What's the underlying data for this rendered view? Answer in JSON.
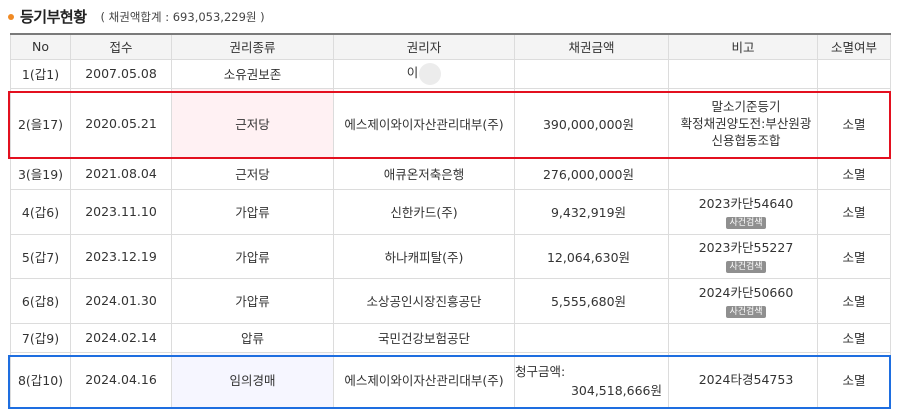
{
  "header": {
    "title": "등기부현황",
    "total_text": "( 채권액합계 : 693,053,229원 )"
  },
  "columns": [
    "No",
    "접수",
    "권리종류",
    "권리자",
    "채권금액",
    "비고",
    "소멸여부"
  ],
  "rows": [
    {
      "no": "1(갑1)",
      "date": "2007.05.08",
      "type": "소유권보존",
      "holder": "이",
      "amount": "",
      "note": "",
      "tag": "",
      "status": ""
    },
    {
      "no": "2(을17)",
      "date": "2020.05.21",
      "type": "근저당",
      "holder": "에스제이와이자산관리대부(주)",
      "amount": "390,000,000원",
      "note": "말소기준등기 확정채권양도전:부산원광신용협동조합",
      "tag": "",
      "status": "소멸"
    },
    {
      "no": "3(을19)",
      "date": "2021.08.04",
      "type": "근저당",
      "holder": "애큐온저축은행",
      "amount": "276,000,000원",
      "note": "",
      "tag": "",
      "status": "소멸"
    },
    {
      "no": "4(갑6)",
      "date": "2023.11.10",
      "type": "가압류",
      "holder": "신한카드(주)",
      "amount": "9,432,919원",
      "note": "2023카단54640",
      "tag": "사건검색",
      "status": "소멸"
    },
    {
      "no": "5(갑7)",
      "date": "2023.12.19",
      "type": "가압류",
      "holder": "하나캐피탈(주)",
      "amount": "12,064,630원",
      "note": "2023카단55227",
      "tag": "사건검색",
      "status": "소멸"
    },
    {
      "no": "6(갑8)",
      "date": "2024.01.30",
      "type": "가압류",
      "holder": "소상공인시장진흥공단",
      "amount": "5,555,680원",
      "note": "2024카단50660",
      "tag": "사건검색",
      "status": "소멸"
    },
    {
      "no": "7(갑9)",
      "date": "2024.02.14",
      "type": "압류",
      "holder": "국민건강보험공단",
      "amount": "",
      "note": "",
      "tag": "",
      "status": "소멸"
    },
    {
      "no": "8(갑10)",
      "date": "2024.04.16",
      "type": "임의경매",
      "holder": "에스제이와이자산관리대부(주)",
      "amount_label": "청구금액:",
      "amount": "304,518,666원",
      "note": "2024타경54753",
      "tag": "",
      "status": "소멸"
    }
  ],
  "note_line1": "말소기준등기",
  "note_line2": "확정채권양도전:부산원광",
  "note_line3": "신용협동조합",
  "colors": {
    "bullet": "#f08a24",
    "highlight_red": "#e3101f",
    "highlight_blue": "#1e6ee0"
  }
}
